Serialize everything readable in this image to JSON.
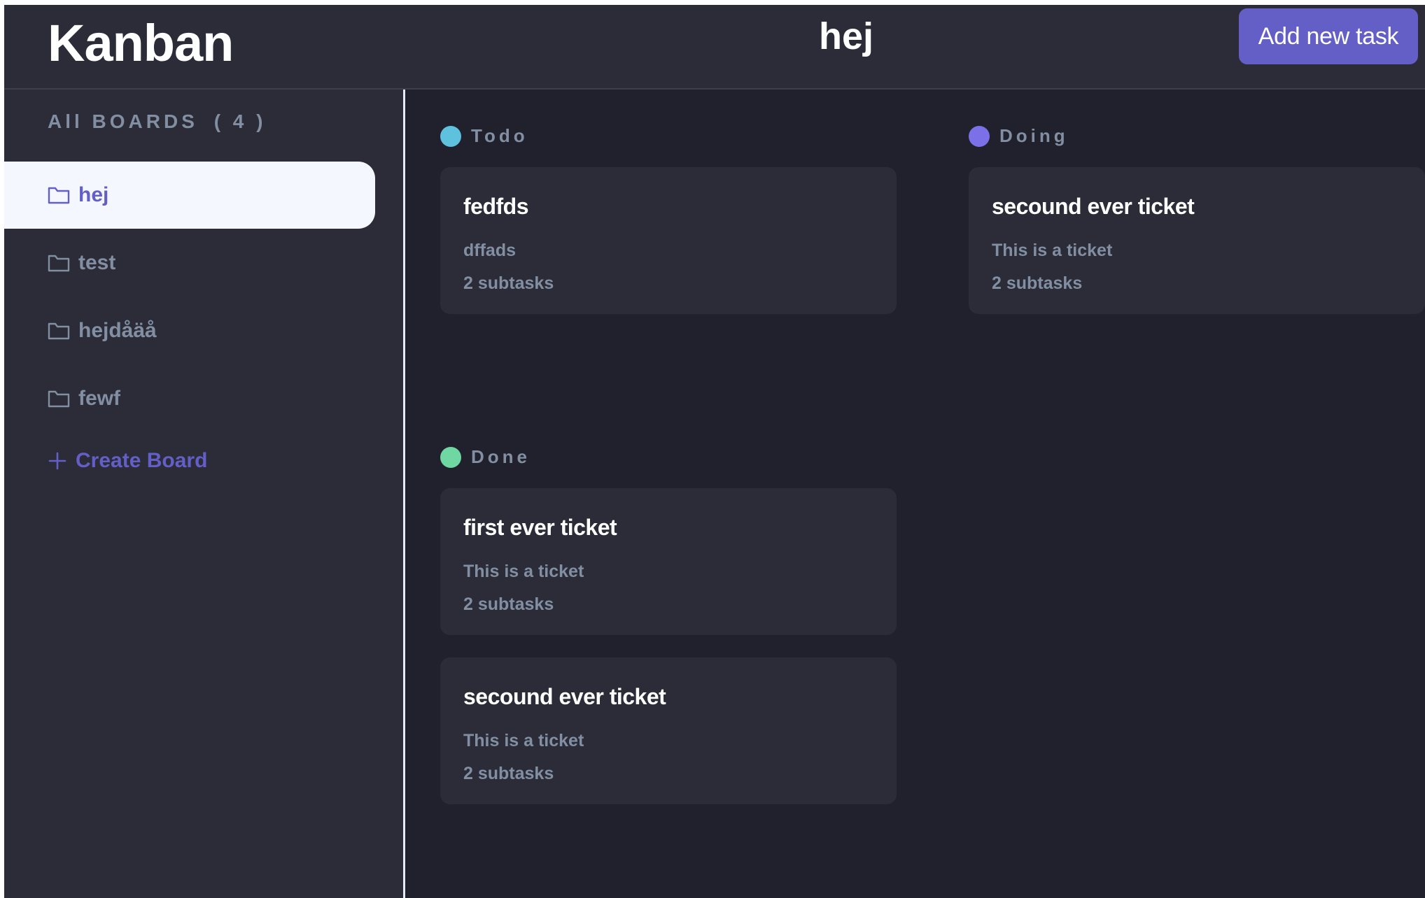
{
  "app": {
    "title": "Kanban"
  },
  "header": {
    "board_title": "hej",
    "add_task_label": "Add new task"
  },
  "sidebar": {
    "heading": "All BOARDS",
    "count": "( 4 )",
    "boards": [
      {
        "label": "hej",
        "active": true
      },
      {
        "label": "test",
        "active": false
      },
      {
        "label": "hejdåäå",
        "active": false
      },
      {
        "label": "fewf",
        "active": false
      }
    ],
    "create_label": "Create Board"
  },
  "columns": [
    {
      "name": "Todo",
      "color": "#5ec1de",
      "cards": [
        {
          "title": "fedfds",
          "description": "dffads",
          "subtasks": "2 subtasks"
        }
      ]
    },
    {
      "name": "Doing",
      "color": "#7c70e8",
      "cards": [
        {
          "title": "secound ever ticket",
          "description": "This is a ticket",
          "subtasks": "2 subtasks"
        }
      ]
    },
    {
      "name": "Done",
      "color": "#6fd7a2",
      "cards": [
        {
          "title": "first ever ticket",
          "description": "This is a ticket",
          "subtasks": "2 subtasks"
        },
        {
          "title": "secound ever ticket",
          "description": "This is a ticket",
          "subtasks": "2 subtasks"
        }
      ]
    }
  ],
  "colors": {
    "accent": "#635fc7",
    "background": "#20212c",
    "panel": "#2b2c37",
    "muted_text": "#828fa3"
  }
}
